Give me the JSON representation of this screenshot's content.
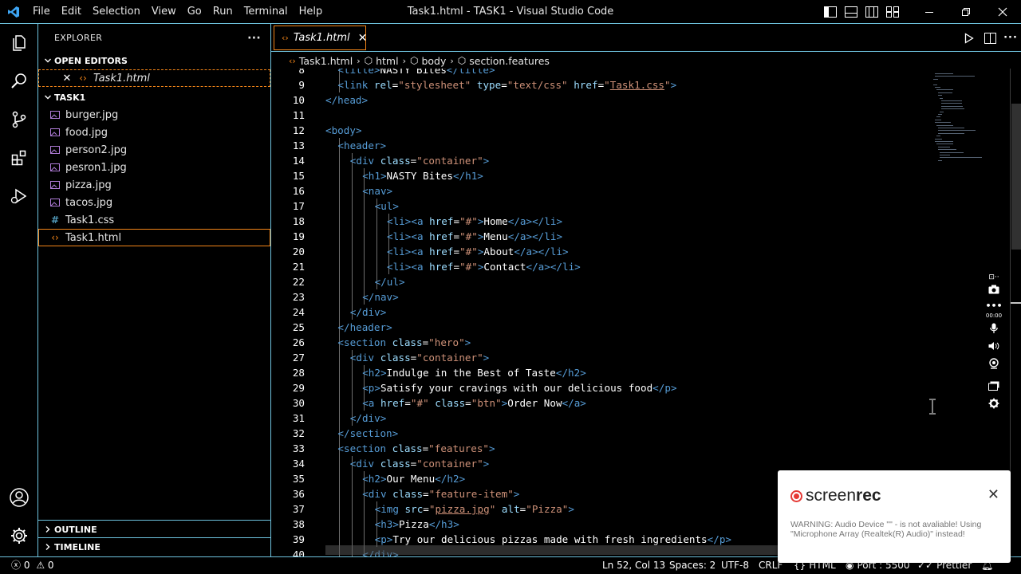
{
  "titlebar": {
    "menu": [
      "File",
      "Edit",
      "Selection",
      "View",
      "Go",
      "Run",
      "Terminal",
      "Help"
    ],
    "title": "Task1.html - TASK1 - Visual Studio Code"
  },
  "sidebar": {
    "header": "EXPLORER",
    "more": "···",
    "open_editors_label": "OPEN EDITORS",
    "open_editors": [
      {
        "name": "Task1.html"
      }
    ],
    "folder_label": "TASK1",
    "files": [
      {
        "name": "burger.jpg",
        "type": "image"
      },
      {
        "name": "food.jpg",
        "type": "image"
      },
      {
        "name": "person2.jpg",
        "type": "image"
      },
      {
        "name": "pesron1.jpg",
        "type": "image"
      },
      {
        "name": "pizza.jpg",
        "type": "image"
      },
      {
        "name": "tacos.jpg",
        "type": "image"
      },
      {
        "name": "Task1.css",
        "type": "css"
      },
      {
        "name": "Task1.html",
        "type": "html"
      }
    ],
    "outline_label": "OUTLINE",
    "timeline_label": "TIMELINE"
  },
  "editor": {
    "tab_label": "Task1.html",
    "breadcrumb": [
      "Task1.html",
      "html",
      "body",
      "section.features"
    ],
    "lines": [
      {
        "n": "8",
        "i": 2,
        "tokens": [
          [
            "t",
            "<"
          ],
          [
            "t",
            "title"
          ],
          [
            "t",
            ">"
          ],
          [
            "x",
            "NASTY Bites"
          ],
          [
            "t",
            "</"
          ],
          [
            "t",
            "title"
          ],
          [
            "t",
            ">"
          ]
        ]
      },
      {
        "n": "9",
        "i": 2,
        "tokens": [
          [
            "t",
            "<"
          ],
          [
            "t",
            "link"
          ],
          [
            "x",
            " "
          ],
          [
            "a",
            "rel"
          ],
          [
            "x",
            "="
          ],
          [
            "s",
            "\"stylesheet\""
          ],
          [
            "x",
            " "
          ],
          [
            "a",
            "type"
          ],
          [
            "x",
            "="
          ],
          [
            "s",
            "\"text/css\""
          ],
          [
            "x",
            " "
          ],
          [
            "a",
            "href"
          ],
          [
            "x",
            "="
          ],
          [
            "s",
            "\""
          ],
          [
            "u",
            "Task1.css"
          ],
          [
            "s",
            "\""
          ],
          [
            "t",
            ">"
          ]
        ]
      },
      {
        "n": "10",
        "i": 1,
        "tokens": [
          [
            "t",
            "</"
          ],
          [
            "t",
            "head"
          ],
          [
            "t",
            ">"
          ]
        ]
      },
      {
        "n": "11",
        "i": 0,
        "tokens": []
      },
      {
        "n": "12",
        "i": 1,
        "tokens": [
          [
            "t",
            "<"
          ],
          [
            "t",
            "body"
          ],
          [
            "t",
            ">"
          ]
        ]
      },
      {
        "n": "13",
        "i": 2,
        "tokens": [
          [
            "t",
            "<"
          ],
          [
            "t",
            "header"
          ],
          [
            "t",
            ">"
          ]
        ]
      },
      {
        "n": "14",
        "i": 3,
        "tokens": [
          [
            "t",
            "<"
          ],
          [
            "t",
            "div"
          ],
          [
            "x",
            " "
          ],
          [
            "a",
            "class"
          ],
          [
            "x",
            "="
          ],
          [
            "s",
            "\"container\""
          ],
          [
            "t",
            ">"
          ]
        ]
      },
      {
        "n": "15",
        "i": 4,
        "tokens": [
          [
            "t",
            "<"
          ],
          [
            "t",
            "h1"
          ],
          [
            "t",
            ">"
          ],
          [
            "x",
            "NASTY Bites"
          ],
          [
            "t",
            "</"
          ],
          [
            "t",
            "h1"
          ],
          [
            "t",
            ">"
          ]
        ]
      },
      {
        "n": "16",
        "i": 4,
        "tokens": [
          [
            "t",
            "<"
          ],
          [
            "t",
            "nav"
          ],
          [
            "t",
            ">"
          ]
        ]
      },
      {
        "n": "17",
        "i": 5,
        "tokens": [
          [
            "t",
            "<"
          ],
          [
            "t",
            "ul"
          ],
          [
            "t",
            ">"
          ]
        ]
      },
      {
        "n": "18",
        "i": 6,
        "tokens": [
          [
            "t",
            "<"
          ],
          [
            "t",
            "li"
          ],
          [
            "t",
            "><"
          ],
          [
            "t",
            "a"
          ],
          [
            "x",
            " "
          ],
          [
            "a",
            "href"
          ],
          [
            "x",
            "="
          ],
          [
            "s",
            "\"#\""
          ],
          [
            "t",
            ">"
          ],
          [
            "x",
            "Home"
          ],
          [
            "t",
            "</"
          ],
          [
            "t",
            "a"
          ],
          [
            "t",
            "></"
          ],
          [
            "t",
            "li"
          ],
          [
            "t",
            ">"
          ]
        ]
      },
      {
        "n": "19",
        "i": 6,
        "tokens": [
          [
            "t",
            "<"
          ],
          [
            "t",
            "li"
          ],
          [
            "t",
            "><"
          ],
          [
            "t",
            "a"
          ],
          [
            "x",
            " "
          ],
          [
            "a",
            "href"
          ],
          [
            "x",
            "="
          ],
          [
            "s",
            "\"#\""
          ],
          [
            "t",
            ">"
          ],
          [
            "x",
            "Menu"
          ],
          [
            "t",
            "</"
          ],
          [
            "t",
            "a"
          ],
          [
            "t",
            "></"
          ],
          [
            "t",
            "li"
          ],
          [
            "t",
            ">"
          ]
        ]
      },
      {
        "n": "20",
        "i": 6,
        "tokens": [
          [
            "t",
            "<"
          ],
          [
            "t",
            "li"
          ],
          [
            "t",
            "><"
          ],
          [
            "t",
            "a"
          ],
          [
            "x",
            " "
          ],
          [
            "a",
            "href"
          ],
          [
            "x",
            "="
          ],
          [
            "s",
            "\"#\""
          ],
          [
            "t",
            ">"
          ],
          [
            "x",
            "About"
          ],
          [
            "t",
            "</"
          ],
          [
            "t",
            "a"
          ],
          [
            "t",
            "></"
          ],
          [
            "t",
            "li"
          ],
          [
            "t",
            ">"
          ]
        ]
      },
      {
        "n": "21",
        "i": 6,
        "tokens": [
          [
            "t",
            "<"
          ],
          [
            "t",
            "li"
          ],
          [
            "t",
            "><"
          ],
          [
            "t",
            "a"
          ],
          [
            "x",
            " "
          ],
          [
            "a",
            "href"
          ],
          [
            "x",
            "="
          ],
          [
            "s",
            "\"#\""
          ],
          [
            "t",
            ">"
          ],
          [
            "x",
            "Contact"
          ],
          [
            "t",
            "</"
          ],
          [
            "t",
            "a"
          ],
          [
            "t",
            "></"
          ],
          [
            "t",
            "li"
          ],
          [
            "t",
            ">"
          ]
        ]
      },
      {
        "n": "22",
        "i": 5,
        "tokens": [
          [
            "t",
            "</"
          ],
          [
            "t",
            "ul"
          ],
          [
            "t",
            ">"
          ]
        ]
      },
      {
        "n": "23",
        "i": 4,
        "tokens": [
          [
            "t",
            "</"
          ],
          [
            "t",
            "nav"
          ],
          [
            "t",
            ">"
          ]
        ]
      },
      {
        "n": "24",
        "i": 3,
        "tokens": [
          [
            "t",
            "</"
          ],
          [
            "t",
            "div"
          ],
          [
            "t",
            ">"
          ]
        ]
      },
      {
        "n": "25",
        "i": 2,
        "tokens": [
          [
            "t",
            "</"
          ],
          [
            "t",
            "header"
          ],
          [
            "t",
            ">"
          ]
        ]
      },
      {
        "n": "26",
        "i": 2,
        "tokens": [
          [
            "t",
            "<"
          ],
          [
            "t",
            "section"
          ],
          [
            "x",
            " "
          ],
          [
            "a",
            "class"
          ],
          [
            "x",
            "="
          ],
          [
            "s",
            "\"hero\""
          ],
          [
            "t",
            ">"
          ]
        ]
      },
      {
        "n": "27",
        "i": 3,
        "tokens": [
          [
            "t",
            "<"
          ],
          [
            "t",
            "div"
          ],
          [
            "x",
            " "
          ],
          [
            "a",
            "class"
          ],
          [
            "x",
            "="
          ],
          [
            "s",
            "\"container\""
          ],
          [
            "t",
            ">"
          ]
        ]
      },
      {
        "n": "28",
        "i": 4,
        "tokens": [
          [
            "t",
            "<"
          ],
          [
            "t",
            "h2"
          ],
          [
            "t",
            ">"
          ],
          [
            "x",
            "Indulge in the Best of Taste"
          ],
          [
            "t",
            "</"
          ],
          [
            "t",
            "h2"
          ],
          [
            "t",
            ">"
          ]
        ]
      },
      {
        "n": "29",
        "i": 4,
        "tokens": [
          [
            "t",
            "<"
          ],
          [
            "t",
            "p"
          ],
          [
            "t",
            ">"
          ],
          [
            "x",
            "Satisfy your cravings with our delicious food"
          ],
          [
            "t",
            "</"
          ],
          [
            "t",
            "p"
          ],
          [
            "t",
            ">"
          ]
        ]
      },
      {
        "n": "30",
        "i": 4,
        "tokens": [
          [
            "t",
            "<"
          ],
          [
            "t",
            "a"
          ],
          [
            "x",
            " "
          ],
          [
            "a",
            "href"
          ],
          [
            "x",
            "="
          ],
          [
            "s",
            "\"#\""
          ],
          [
            "x",
            " "
          ],
          [
            "a",
            "class"
          ],
          [
            "x",
            "="
          ],
          [
            "s",
            "\"btn\""
          ],
          [
            "t",
            ">"
          ],
          [
            "x",
            "Order Now"
          ],
          [
            "t",
            "</"
          ],
          [
            "t",
            "a"
          ],
          [
            "t",
            ">"
          ]
        ]
      },
      {
        "n": "31",
        "i": 3,
        "tokens": [
          [
            "t",
            "</"
          ],
          [
            "t",
            "div"
          ],
          [
            "t",
            ">"
          ]
        ]
      },
      {
        "n": "32",
        "i": 2,
        "tokens": [
          [
            "t",
            "</"
          ],
          [
            "t",
            "section"
          ],
          [
            "t",
            ">"
          ]
        ]
      },
      {
        "n": "33",
        "i": 2,
        "tokens": [
          [
            "t",
            "<"
          ],
          [
            "t",
            "section"
          ],
          [
            "x",
            " "
          ],
          [
            "a",
            "class"
          ],
          [
            "x",
            "="
          ],
          [
            "s",
            "\"features\""
          ],
          [
            "t",
            ">"
          ]
        ]
      },
      {
        "n": "34",
        "i": 3,
        "tokens": [
          [
            "t",
            "<"
          ],
          [
            "t",
            "div"
          ],
          [
            "x",
            " "
          ],
          [
            "a",
            "class"
          ],
          [
            "x",
            "="
          ],
          [
            "s",
            "\"container\""
          ],
          [
            "t",
            ">"
          ]
        ]
      },
      {
        "n": "35",
        "i": 4,
        "tokens": [
          [
            "t",
            "<"
          ],
          [
            "t",
            "h2"
          ],
          [
            "t",
            ">"
          ],
          [
            "x",
            "Our Menu"
          ],
          [
            "t",
            "</"
          ],
          [
            "t",
            "h2"
          ],
          [
            "t",
            ">"
          ]
        ]
      },
      {
        "n": "36",
        "i": 4,
        "tokens": [
          [
            "t",
            "<"
          ],
          [
            "t",
            "div"
          ],
          [
            "x",
            " "
          ],
          [
            "a",
            "class"
          ],
          [
            "x",
            "="
          ],
          [
            "s",
            "\"feature-item\""
          ],
          [
            "t",
            ">"
          ]
        ]
      },
      {
        "n": "37",
        "i": 5,
        "tokens": [
          [
            "t",
            "<"
          ],
          [
            "t",
            "img"
          ],
          [
            "x",
            " "
          ],
          [
            "a",
            "src"
          ],
          [
            "x",
            "="
          ],
          [
            "s",
            "\""
          ],
          [
            "u",
            "pizza.jpg"
          ],
          [
            "s",
            "\""
          ],
          [
            "x",
            " "
          ],
          [
            "a",
            "alt"
          ],
          [
            "x",
            "="
          ],
          [
            "s",
            "\"Pizza\""
          ],
          [
            "t",
            ">"
          ]
        ]
      },
      {
        "n": "38",
        "i": 5,
        "tokens": [
          [
            "t",
            "<"
          ],
          [
            "t",
            "h3"
          ],
          [
            "t",
            ">"
          ],
          [
            "x",
            "Pizza"
          ],
          [
            "t",
            "</"
          ],
          [
            "t",
            "h3"
          ],
          [
            "t",
            ">"
          ]
        ]
      },
      {
        "n": "39",
        "i": 5,
        "tokens": [
          [
            "t",
            "<"
          ],
          [
            "t",
            "p"
          ],
          [
            "t",
            ">"
          ],
          [
            "x",
            "Try our delicious pizzas made with fresh ingredients"
          ],
          [
            "t",
            "</"
          ],
          [
            "t",
            "p"
          ],
          [
            "t",
            ">"
          ]
        ]
      },
      {
        "n": "40",
        "i": 4,
        "tokens": [
          [
            "t",
            "</"
          ],
          [
            "t",
            "div"
          ],
          [
            "t",
            ">"
          ]
        ]
      }
    ]
  },
  "statusbar": {
    "problems": "0",
    "warnings": "0",
    "cursor": "Ln 52, Col 13",
    "spaces": "Spaces: 2",
    "encoding": "UTF-8",
    "eol": "CRLF",
    "language": "HTML",
    "port": "Port : 5500",
    "prettier": "Prettier"
  },
  "screenrec": {
    "brand_a": "screen",
    "brand_b": "rec",
    "timer": "00:00",
    "warning": "WARNING: Audio Device \"\" - is not avaliable! Using \"Microphone Array (Realtek(R) Audio)\" instead!"
  },
  "colors": {
    "accent_border": "#6fc3df",
    "focus_border": "#f38518",
    "tag": "#569cd6",
    "attribute": "#9cdcfe",
    "string": "#ce9178"
  }
}
